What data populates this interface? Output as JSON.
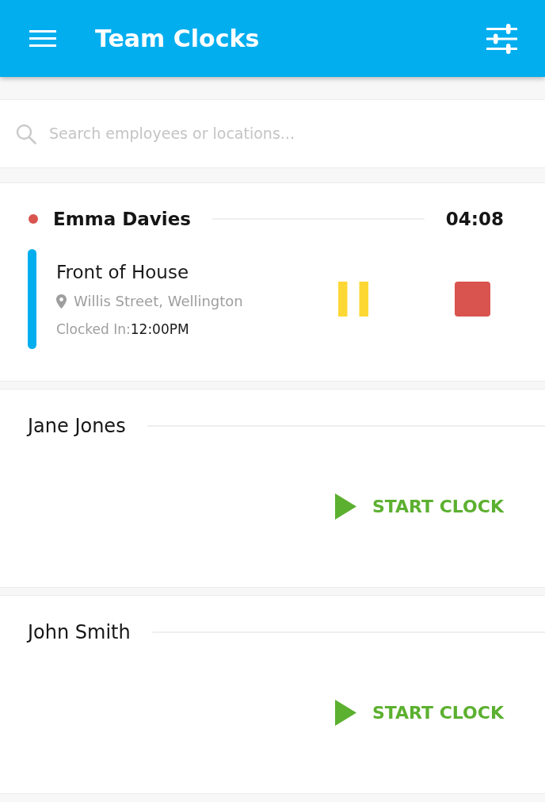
{
  "app_bar": {
    "title": "Team Clocks"
  },
  "search": {
    "placeholder": "Search employees or locations..."
  },
  "employees": [
    {
      "kind": "clocked_in",
      "name": "Emma Davies",
      "color": "#d9534f",
      "elapsed": "04:08",
      "role": "Front of House",
      "location": "Willis Street, Wellington",
      "clocked_in_label": "Clocked In:",
      "clocked_in_time": "12:00PM"
    },
    {
      "kind": "idle",
      "name": "Jane Jones",
      "action": "START CLOCK"
    },
    {
      "kind": "idle",
      "name": "John Smith",
      "action": "START CLOCK"
    }
  ]
}
